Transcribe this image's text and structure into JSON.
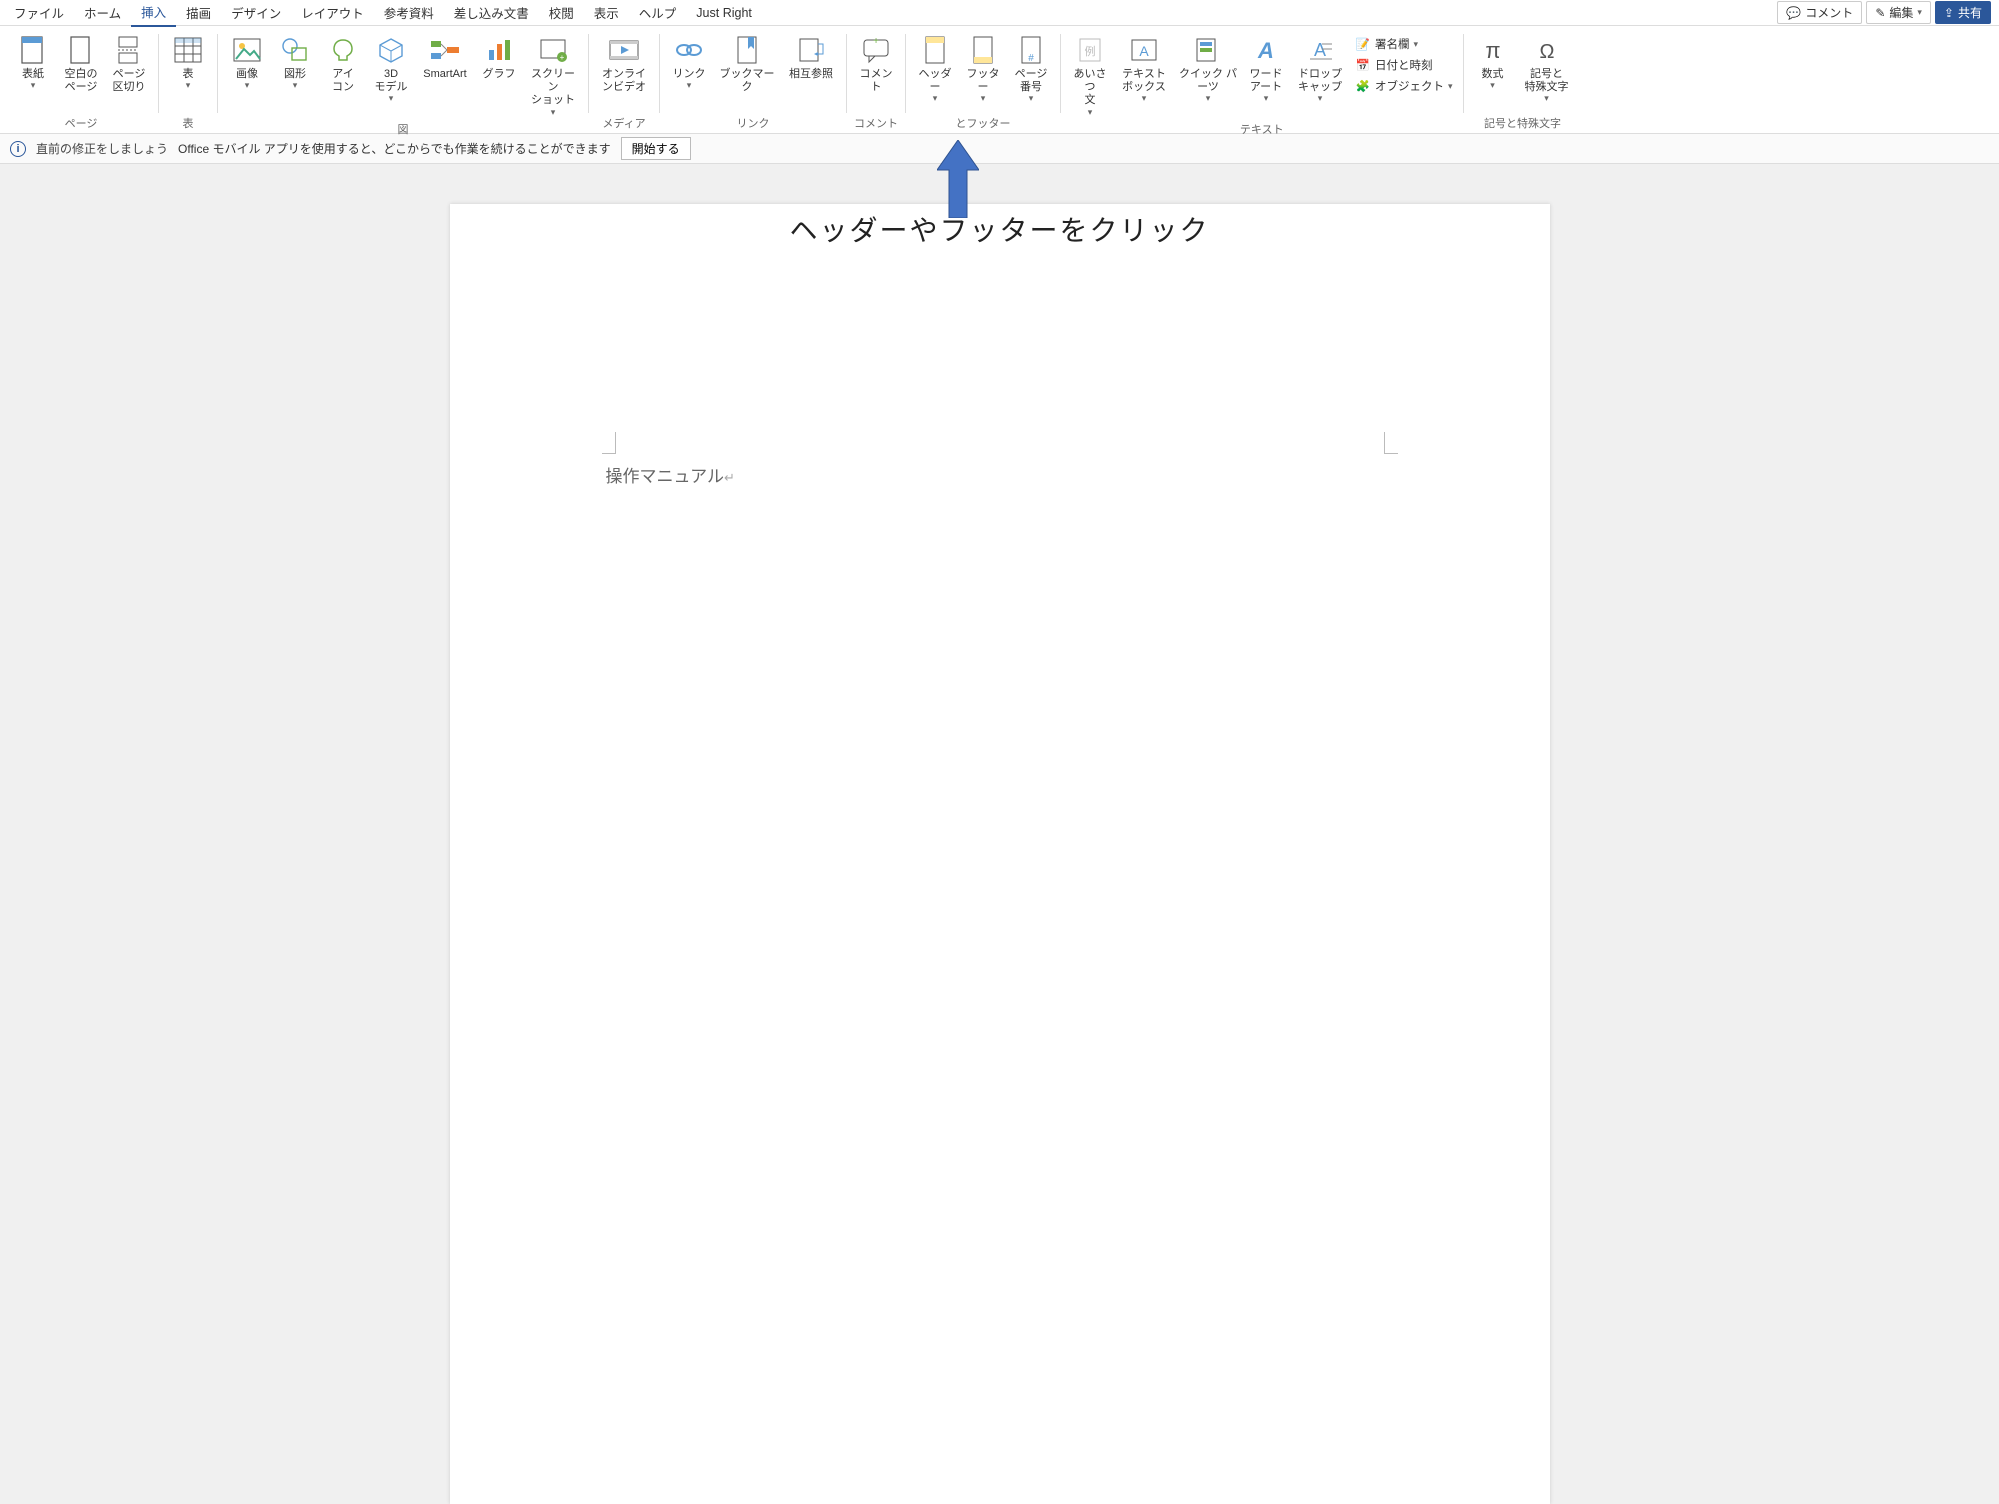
{
  "tabs": {
    "file": "ファイル",
    "home": "ホーム",
    "insert": "挿入",
    "draw": "描画",
    "design": "デザイン",
    "layout": "レイアウト",
    "references": "参考資料",
    "mailings": "差し込み文書",
    "review": "校閲",
    "view": "表示",
    "help": "ヘルプ",
    "justright": "Just Right"
  },
  "topbar": {
    "comment": "コメント",
    "edit": "編集",
    "share": "共有"
  },
  "ribbon": {
    "pages": {
      "label": "ページ",
      "cover": "表紙",
      "blank": "空白の\nページ",
      "break": "ページ\n区切り"
    },
    "tables": {
      "label": "表",
      "table": "表"
    },
    "illustrations": {
      "label": "図",
      "picture": "画像",
      "shapes": "図形",
      "icons": "アイ\nコン",
      "model3d": "3D\nモデル",
      "smartart": "SmartArt",
      "chart": "グラフ",
      "screenshot": "スクリーン\nショット"
    },
    "media": {
      "label": "メディア",
      "onlinevideo": "オンライ\nンビデオ"
    },
    "links": {
      "label": "リンク",
      "link": "リンク",
      "bookmark": "ブックマーク",
      "crossref": "相互参照"
    },
    "comments": {
      "label": "コメント",
      "comment": "コメント"
    },
    "headerfooter": {
      "label": "とフッター",
      "header": "ヘッダー",
      "footer": "フッター",
      "pagenum": "ページ\n番号"
    },
    "text": {
      "label": "テキスト",
      "aisatsu": "あいさつ\n文",
      "textbox": "テキスト\nボックス",
      "quick": "クイック パーツ",
      "wordart": "ワード\nアート",
      "dropcap": "ドロップ\nキャップ",
      "signline": "署名欄",
      "datetime": "日付と時刻",
      "object": "オブジェクト"
    },
    "symbols": {
      "label": "記号と特殊文字",
      "equation": "数式",
      "symbol": "記号と\n特殊文字"
    }
  },
  "infobar": {
    "title": "直前の修正をしましょう",
    "body": "Office モバイル アプリを使用すると、どこからでも作業を続けることができます",
    "start": "開始する"
  },
  "overlay": {
    "instruction": "ヘッダーやフッターをクリック"
  },
  "document": {
    "header_text": "操作マニュアル"
  }
}
